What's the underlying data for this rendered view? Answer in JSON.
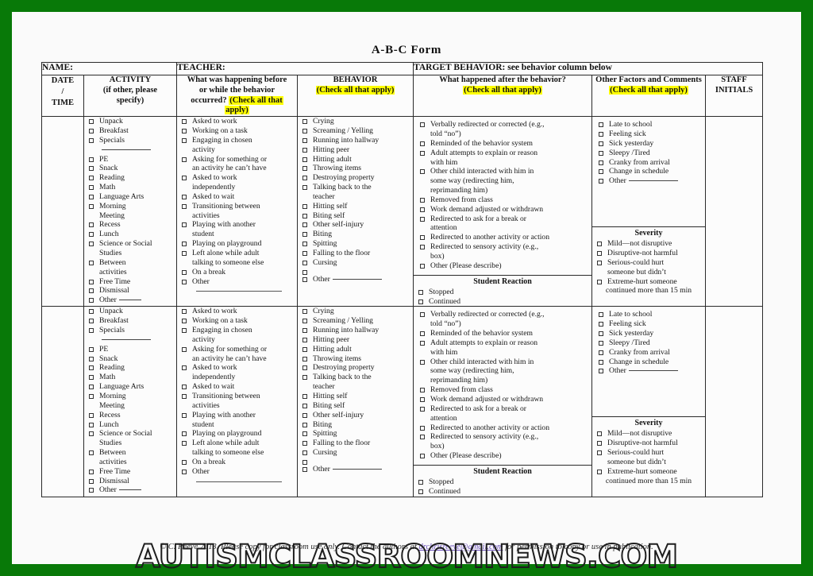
{
  "page": {
    "title": "A-B-C Form",
    "border_color": "#087908",
    "highlight_color": "#ffff00"
  },
  "header_strip": {
    "name_label": "NAME:",
    "teacher_label": "TEACHER:",
    "target_behavior_label": "TARGET BEHAVIOR: see behavior column below"
  },
  "columns": {
    "date_time": [
      "DATE",
      "/",
      "TIME"
    ],
    "activity": {
      "line1": "ACTIVITY",
      "line2": "(if other, please",
      "line3": "specify)"
    },
    "antecedent": {
      "line1": "What was happening before",
      "line2": "or while the behavior",
      "line3": "occurred?",
      "highlight1": "(Check all that",
      "highlight2": "apply)"
    },
    "behavior": {
      "line1": "BEHAVIOR",
      "highlight": "(Check all that apply)"
    },
    "consequence": {
      "line1": "What happened after the behavior?",
      "highlight": "(Check all that apply)"
    },
    "other_factors": {
      "line1": "Other Factors and Comments",
      "highlight": "(Check all that apply)"
    },
    "staff_initials": {
      "line1": "STAFF",
      "line2": "INITIALS"
    }
  },
  "lists": {
    "activity": [
      {
        "text": "Unpack"
      },
      {
        "text": "Breakfast"
      },
      {
        "text": "Specials",
        "rule": "long"
      },
      {
        "text": "PE"
      },
      {
        "text": "Snack"
      },
      {
        "text": "Reading"
      },
      {
        "text": "Math"
      },
      {
        "text": "Language Arts"
      },
      {
        "text": "Morning"
      },
      {
        "text": "Meeting",
        "cont": true
      },
      {
        "text": "Recess"
      },
      {
        "text": "Lunch"
      },
      {
        "text": "Science or Social"
      },
      {
        "text": "Studies",
        "cont": true
      },
      {
        "text": "Between"
      },
      {
        "text": "activities",
        "cont": true
      },
      {
        "text": "Free Time"
      },
      {
        "text": "Dismissal"
      },
      {
        "text": "Other",
        "rule": "short"
      }
    ],
    "antecedent": [
      {
        "text": "Asked to work"
      },
      {
        "text": "Working on a task"
      },
      {
        "text": "Engaging in chosen"
      },
      {
        "text": "activity",
        "cont": true
      },
      {
        "text": "Asking for something or"
      },
      {
        "text": "an activity he can’t have",
        "cont": true
      },
      {
        "text": "Asked to work"
      },
      {
        "text": "independently",
        "cont": true
      },
      {
        "text": "Asked to wait"
      },
      {
        "text": "Transitioning between"
      },
      {
        "text": "activities",
        "cont": true
      },
      {
        "text": "Playing with another"
      },
      {
        "text": "student",
        "cont": true
      },
      {
        "text": "Playing on playground"
      },
      {
        "text": "Left alone while adult"
      },
      {
        "text": "talking to someone else",
        "cont": true
      },
      {
        "text": "On a break"
      },
      {
        "text": "Other"
      }
    ],
    "behavior": [
      {
        "text": "Crying"
      },
      {
        "text": "Screaming / Yelling"
      },
      {
        "text": "Running into hallway"
      },
      {
        "text": "Hitting peer"
      },
      {
        "text": "Hitting adult"
      },
      {
        "text": "Throwing items"
      },
      {
        "text": "Destroying property"
      },
      {
        "text": "Talking back to the"
      },
      {
        "text": "teacher",
        "cont": true
      },
      {
        "text": "Hitting self"
      },
      {
        "text": "Biting self"
      },
      {
        "text": "Other self-injury"
      },
      {
        "text": "Biting"
      },
      {
        "text": "Spitting"
      },
      {
        "text": "Falling to the floor"
      },
      {
        "text": "Cursing"
      },
      {
        "text": ""
      },
      {
        "text": "Other",
        "rule": "long"
      }
    ],
    "consequence": [
      {
        "text": "Verbally redirected or corrected (e.g.,"
      },
      {
        "text": "told “no”)",
        "cont": true
      },
      {
        "text": "Reminded of the behavior system"
      },
      {
        "text": "Adult attempts to explain or reason"
      },
      {
        "text": "with him",
        "cont": true
      },
      {
        "text": "Other child interacted with him in"
      },
      {
        "text": "some way (redirecting him,",
        "cont": true
      },
      {
        "text": "reprimanding him)",
        "cont": true
      },
      {
        "text": "Removed from class"
      },
      {
        "text": "Work demand adjusted or withdrawn"
      },
      {
        "text": "Redirected to ask for a break or"
      },
      {
        "text": "attention",
        "cont": true
      },
      {
        "text": "Redirected to another activity or action"
      },
      {
        "text": "Redirected to sensory activity (e.g.,"
      },
      {
        "text": "box)",
        "cont": true
      },
      {
        "text": "Other (Please describe)"
      }
    ],
    "student_reaction": {
      "heading": "Student Reaction",
      "items": [
        {
          "text": "Stopped"
        },
        {
          "text": "Continued"
        }
      ]
    },
    "other_factors": [
      {
        "text": "Late to school"
      },
      {
        "text": "Feeling sick"
      },
      {
        "text": "Sick yesterday"
      },
      {
        "text": "Sleepy /Tired"
      },
      {
        "text": "Cranky from arrival"
      },
      {
        "text": "Change in schedule"
      },
      {
        "text": "Other",
        "rule": "long"
      }
    ],
    "severity": {
      "heading": "Severity",
      "items": [
        {
          "text": "Mild—not disruptive"
        },
        {
          "text": "Disruptive-not harmful"
        },
        {
          "text": "Serious-could hurt"
        },
        {
          "text": "someone but didn’t",
          "cont": true
        },
        {
          "text": "Extreme-hurt someone"
        }
      ],
      "tail": "continued more than 15 min"
    }
  },
  "footer": {
    "part1": "© C. Reeve 2013. Please copy for classroom use only.  Contact the authors at ",
    "email": "drchrisreeve@gmail.com",
    "part2": " for permission to copy or use in publication."
  },
  "watermark": {
    "text": "AUTISMCLASSROOMNEWS.COM"
  }
}
